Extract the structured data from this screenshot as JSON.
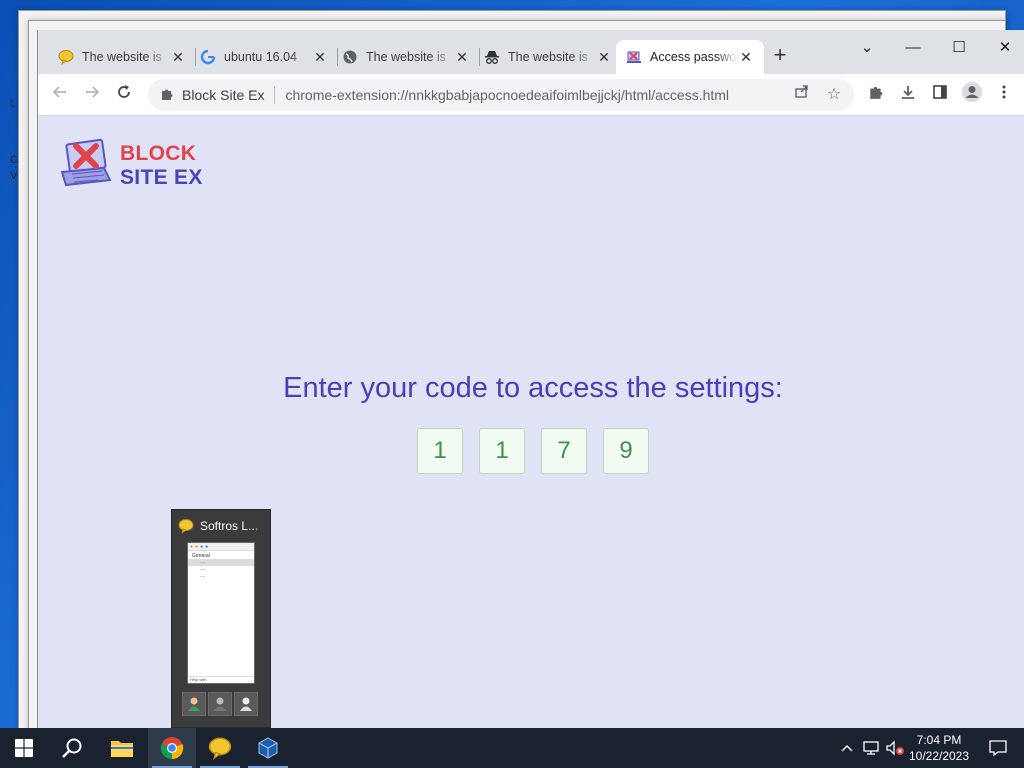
{
  "desktop": {
    "left_strip_chars": [
      "L",
      "C",
      "V"
    ]
  },
  "browser": {
    "tabs": [
      {
        "label": "The website is",
        "icon": "softros-chat-icon"
      },
      {
        "label": "ubuntu 16.04",
        "icon": "google-icon"
      },
      {
        "label": "The website is",
        "icon": "globe-icon"
      },
      {
        "label": "The website is",
        "icon": "incognito-icon"
      },
      {
        "label": "Access password",
        "icon": "block-site-icon",
        "active": true
      }
    ],
    "new_tab_symbol": "+",
    "window_controls": {
      "tab_search": "⌄",
      "minimize": "—",
      "maximize": "☐",
      "close": "✕"
    },
    "address": {
      "extension_name": "Block Site Ex",
      "url": "chrome-extension://nnkkgbabjapocnoedeaifoimlbejjckj/html/access.html"
    }
  },
  "page": {
    "logo": {
      "line1": "BLOCK",
      "line2": "SITE EX",
      "colors": {
        "block": "#e2434b",
        "site_ex": "#4b44b6"
      }
    },
    "heading": "Enter your code to access the settings:",
    "code_digits": [
      "1",
      "1",
      "7",
      "9"
    ],
    "colors": {
      "background": "#dfe3f5",
      "heading": "#4b3fb4",
      "digit": "#3f8f4f"
    }
  },
  "taskbar_preview": {
    "title": "Softros L...",
    "thumbnail": {
      "group": "General",
      "items": [
        "....",
        "....",
        "...."
      ],
      "footer": "Help with"
    }
  },
  "taskbar": {
    "items": [
      "windows-start-icon",
      "search-icon",
      "file-explorer-icon",
      "chrome-icon",
      "softros-chat-icon",
      "virtualbox-icon"
    ],
    "clock": {
      "time": "7:04 PM",
      "date": "10/22/2023"
    }
  }
}
